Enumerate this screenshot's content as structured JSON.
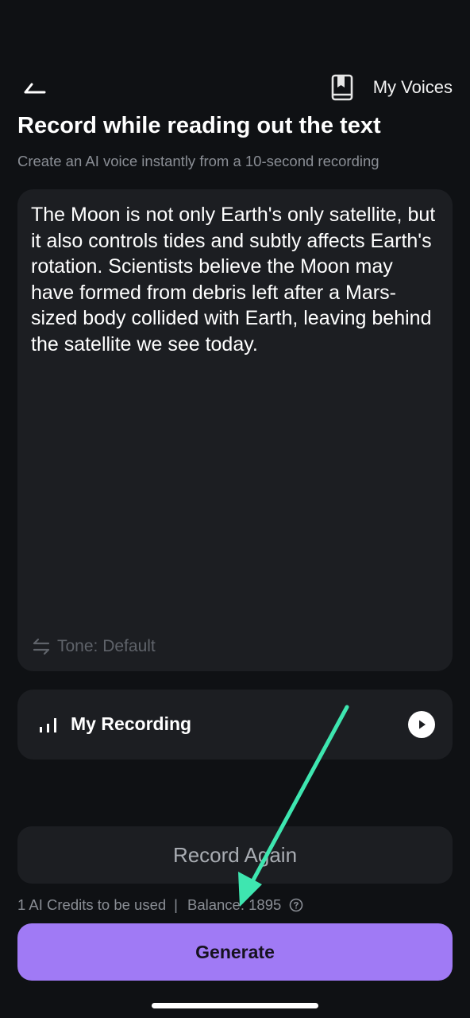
{
  "header": {
    "back_icon": "back-arrow-icon",
    "my_voices_label": "My Voices",
    "my_voices_icon": "book-icon"
  },
  "title": "Record while reading out the text",
  "subtitle": "Create an AI voice instantly from a 10-second recording",
  "reading_card": {
    "text": "The Moon is not only Earth's only satellite, but it also controls tides and subtly affects Earth's rotation. Scientists believe the Moon may have formed from debris left after a Mars-sized body collided with Earth, leaving behind the satellite we see today.",
    "tone_icon": "swap-arrows-icon",
    "tone_label": "Tone: Default"
  },
  "recording": {
    "icon": "waveform-icon",
    "label": "My Recording",
    "play_icon": "play-icon"
  },
  "record_again_label": "Record Again",
  "credits": {
    "used": "1 AI Credits to be used",
    "separator": "|",
    "balance": "Balance: 1895",
    "help_icon": "help-circle-icon"
  },
  "generate_label": "Generate",
  "colors": {
    "background": "#0f1114",
    "card": "#1c1e22",
    "accent": "#a07af5",
    "annotation_arrow": "#3ee6b0"
  }
}
